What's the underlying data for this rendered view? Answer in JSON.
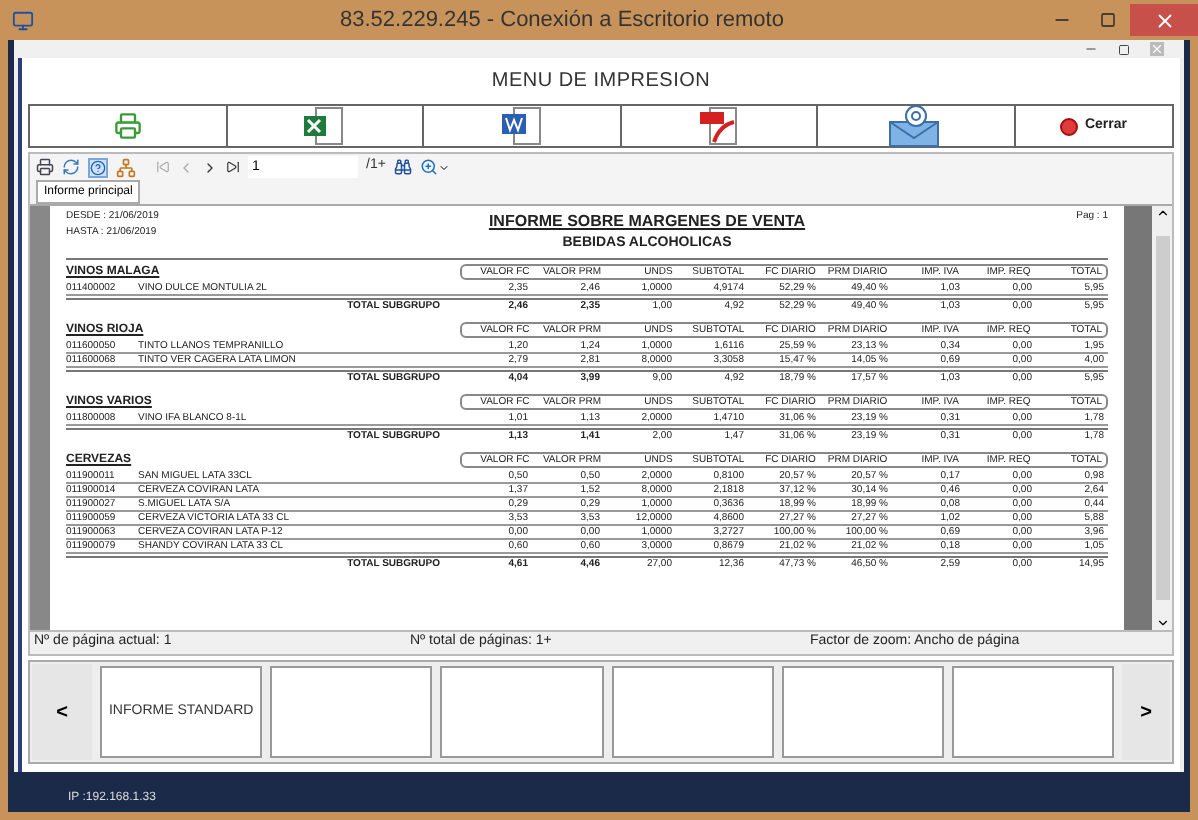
{
  "window": {
    "title": "83.52.229.245 - Conexión a Escritorio remoto"
  },
  "menu_title": "MENU DE IMPRESION",
  "export_buttons": [
    {
      "kind": "print"
    },
    {
      "kind": "excel"
    },
    {
      "kind": "word"
    },
    {
      "kind": "pdf"
    },
    {
      "kind": "email"
    },
    {
      "kind": "close",
      "label": "Cerrar"
    }
  ],
  "toolbar": {
    "page_field": "1",
    "page_count": "/1+"
  },
  "tabs": [
    {
      "label": "Informe principal",
      "selected": true
    }
  ],
  "report": {
    "desde": "DESDE :  21/06/2019",
    "hasta": "HASTA :  21/06/2019",
    "title": "INFORME SOBRE MARGENES DE VENTA",
    "subtitle": "BEBIDAS ALCOHOLICAS",
    "page": "Pag : 1",
    "groups": [
      {
        "name": "VINOS MALAGA",
        "columns": [
          "VALOR FC",
          "VALOR PRM",
          "UNDS",
          "SUBTOTAL",
          "FC DIARIO",
          "PRM DIARIO",
          "IMP. IVA",
          "IMP. REQ",
          "TOTAL"
        ],
        "rows": [
          {
            "code": "011400002",
            "desc": "VINO DULCE MONTULIA 2L",
            "values": [
              "2,35",
              "2,46",
              "1,0000",
              "4,9174",
              "52,29 %",
              "49,40 %",
              "1,03",
              "0,00",
              "5,95"
            ]
          }
        ],
        "total_label": "TOTAL SUBGRUPO",
        "total": [
          "2,46",
          "2,35",
          "1,00",
          "4,92",
          "52,29 %",
          "49,40 %",
          "1,03",
          "0,00",
          "5,95"
        ]
      },
      {
        "name": "VINOS RIOJA",
        "columns": [
          "VALOR FC",
          "VALOR PRM",
          "UNDS",
          "SUBTOTAL",
          "FC DIARIO",
          "PRM DIARIO",
          "IMP. IVA",
          "IMP. REQ",
          "TOTAL"
        ],
        "rows": [
          {
            "code": "011600050",
            "desc": "TINTO LLANOS  TEMPRANILLO",
            "values": [
              "1,20",
              "1,24",
              "1,0000",
              "1,6116",
              "25,59 %",
              "23,13 %",
              "0,34",
              "0,00",
              "1,95"
            ]
          },
          {
            "code": "011600068",
            "desc": "TINTO VER CAGERA LATA LIMON",
            "values": [
              "2,79",
              "2,81",
              "8,0000",
              "3,3058",
              "15,47 %",
              "14,05 %",
              "0,69",
              "0,00",
              "4,00"
            ]
          }
        ],
        "total_label": "TOTAL SUBGRUPO",
        "total": [
          "4,04",
          "3,99",
          "9,00",
          "4,92",
          "18,79 %",
          "17,57 %",
          "1,03",
          "0,00",
          "5,95"
        ]
      },
      {
        "name": "VINOS VARIOS",
        "columns": [
          "VALOR FC",
          "VALOR PRM",
          "UNDS",
          "SUBTOTAL",
          "FC DIARIO",
          "PRM DIARIO",
          "IMP. IVA",
          "IMP. REQ",
          "TOTAL"
        ],
        "rows": [
          {
            "code": "011800008",
            "desc": "VINO IFA BLANCO  8-1L",
            "values": [
              "1,01",
              "1,13",
              "2,0000",
              "1,4710",
              "31,06 %",
              "23,19 %",
              "0,31",
              "0,00",
              "1,78"
            ]
          }
        ],
        "total_label": "TOTAL SUBGRUPO",
        "total": [
          "1,13",
          "1,41",
          "2,00",
          "1,47",
          "31,06 %",
          "23,19 %",
          "0,31",
          "0,00",
          "1,78"
        ]
      },
      {
        "name": "CERVEZAS",
        "columns": [
          "VALOR FC",
          "VALOR PRM",
          "UNDS",
          "SUBTOTAL",
          "FC DIARIO",
          "PRM DIARIO",
          "IMP. IVA",
          "IMP. REQ",
          "TOTAL"
        ],
        "rows": [
          {
            "code": "011900011",
            "desc": "SAN MIGUEL LATA 33CL",
            "values": [
              "0,50",
              "0,50",
              "2,0000",
              "0,8100",
              "20,57 %",
              "20,57 %",
              "0,17",
              "0,00",
              "0,98"
            ]
          },
          {
            "code": "011900014",
            "desc": "CERVEZA COVIRAN LATA",
            "values": [
              "1,37",
              "1,52",
              "8,0000",
              "2,1818",
              "37,12 %",
              "30,14 %",
              "0,46",
              "0,00",
              "2,64"
            ]
          },
          {
            "code": "011900027",
            "desc": "S.MIGUEL LATA S/A",
            "values": [
              "0,29",
              "0,29",
              "1,0000",
              "0,3636",
              "18,99 %",
              "18,99 %",
              "0,08",
              "0,00",
              "0,44"
            ]
          },
          {
            "code": "011900059",
            "desc": "CERVEZA VICTORIA LATA 33 CL",
            "values": [
              "3,53",
              "3,53",
              "12,0000",
              "4,8600",
              "27,27 %",
              "27,27 %",
              "1,02",
              "0,00",
              "5,88"
            ]
          },
          {
            "code": "011900063",
            "desc": "CERVEZA COVIRAN LATA P-12",
            "values": [
              "0,00",
              "0,00",
              "1,0000",
              "3,2727",
              "100,00 %",
              "100,00 %",
              "0,69",
              "0,00",
              "3,96"
            ]
          },
          {
            "code": "011900079",
            "desc": "SHANDY COVIRAN LATA 33 CL",
            "values": [
              "0,60",
              "0,60",
              "3,0000",
              "0,8679",
              "21,02 %",
              "21,02 %",
              "0,18",
              "0,00",
              "1,05"
            ]
          }
        ],
        "total_label": "TOTAL SUBGRUPO",
        "total": [
          "4,61",
          "4,46",
          "27,00",
          "12,36",
          "47,73 %",
          "46,50 %",
          "2,59",
          "0,00",
          "14,95"
        ]
      }
    ]
  },
  "status_bar": [
    "Nº de página actual: 1",
    "Nº total de páginas: 1+",
    "Factor de zoom: Ancho de página"
  ],
  "nav": {
    "prev": "<",
    "next": ">"
  },
  "tiles": [
    {
      "kind": "label",
      "label": "INFORME STANDARD"
    },
    {
      "kind": "empty"
    },
    {
      "kind": "empty"
    },
    {
      "kind": "empty"
    },
    {
      "kind": "empty"
    },
    {
      "kind": "empty"
    }
  ],
  "taskbar": {
    "ip": "IP :192.168.1.33"
  }
}
